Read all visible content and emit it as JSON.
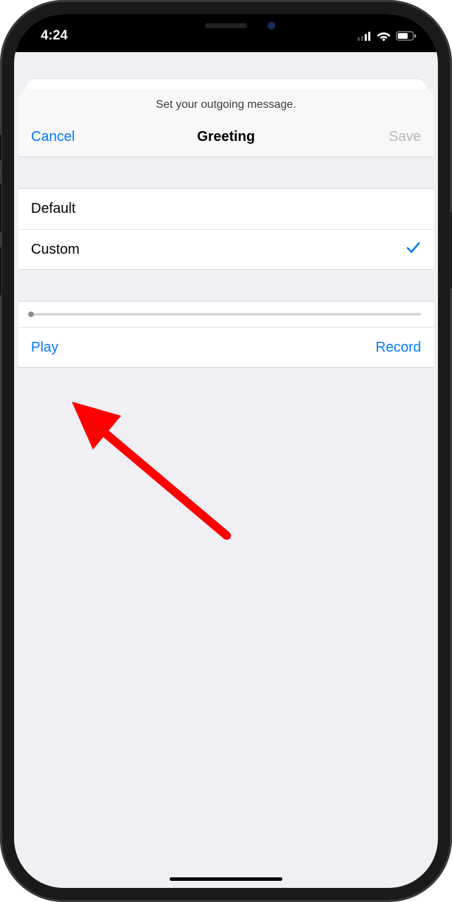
{
  "status": {
    "time": "4:24"
  },
  "sheet": {
    "prompt": "Set your outgoing message.",
    "cancel": "Cancel",
    "title": "Greeting",
    "save": "Save"
  },
  "options": {
    "default_label": "Default",
    "custom_label": "Custom"
  },
  "controls": {
    "play": "Play",
    "record": "Record"
  },
  "colors": {
    "ios_blue": "#007aff",
    "annotation_red": "#ff0000"
  }
}
